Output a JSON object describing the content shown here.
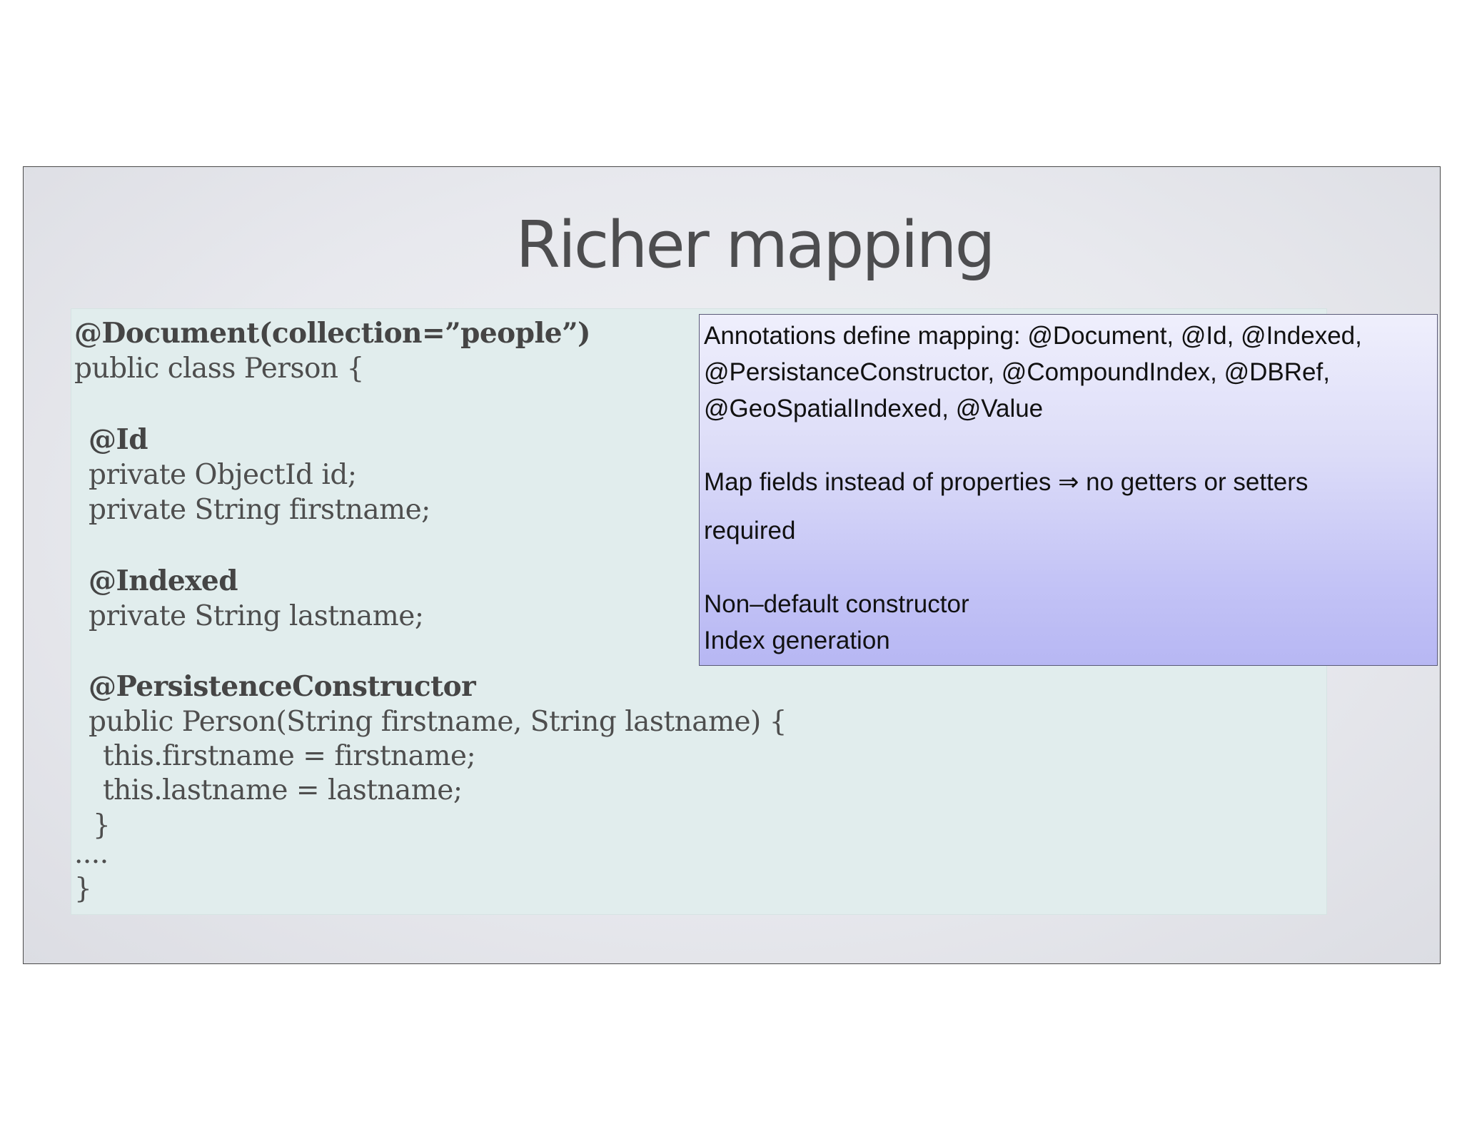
{
  "slide": {
    "title": "Richer mapping",
    "code": {
      "lines": [
        "@Document(collection=”people”)",
        "public class Person {",
        "@Id",
        "private ObjectId id;",
        "private String firstname;",
        "@Indexed",
        "private String lastname;",
        "@PersistenceConstructor",
        "public Person(String firstname, String lastname) {",
        "this.firstname = firstname;",
        "this.lastname = lastname;",
        "}",
        "....",
        "}"
      ]
    },
    "notes": {
      "lines": [
        "Annotations define mapping: @Document, @Id, @Indexed,",
        "@PersistanceConstructor, @CompoundIndex, @DBRef,",
        "@GeoSpatialIndexed, @Value",
        "Map fields instead of properties ⇒ no getters or setters",
        "required",
        "Non–default constructor",
        "Index generation"
      ]
    }
  },
  "colors": {
    "title": "#4d4d4f",
    "code_panel": "#e1eded",
    "note_box_top": "#efeffc",
    "note_box_bottom": "#b7b7f3"
  }
}
